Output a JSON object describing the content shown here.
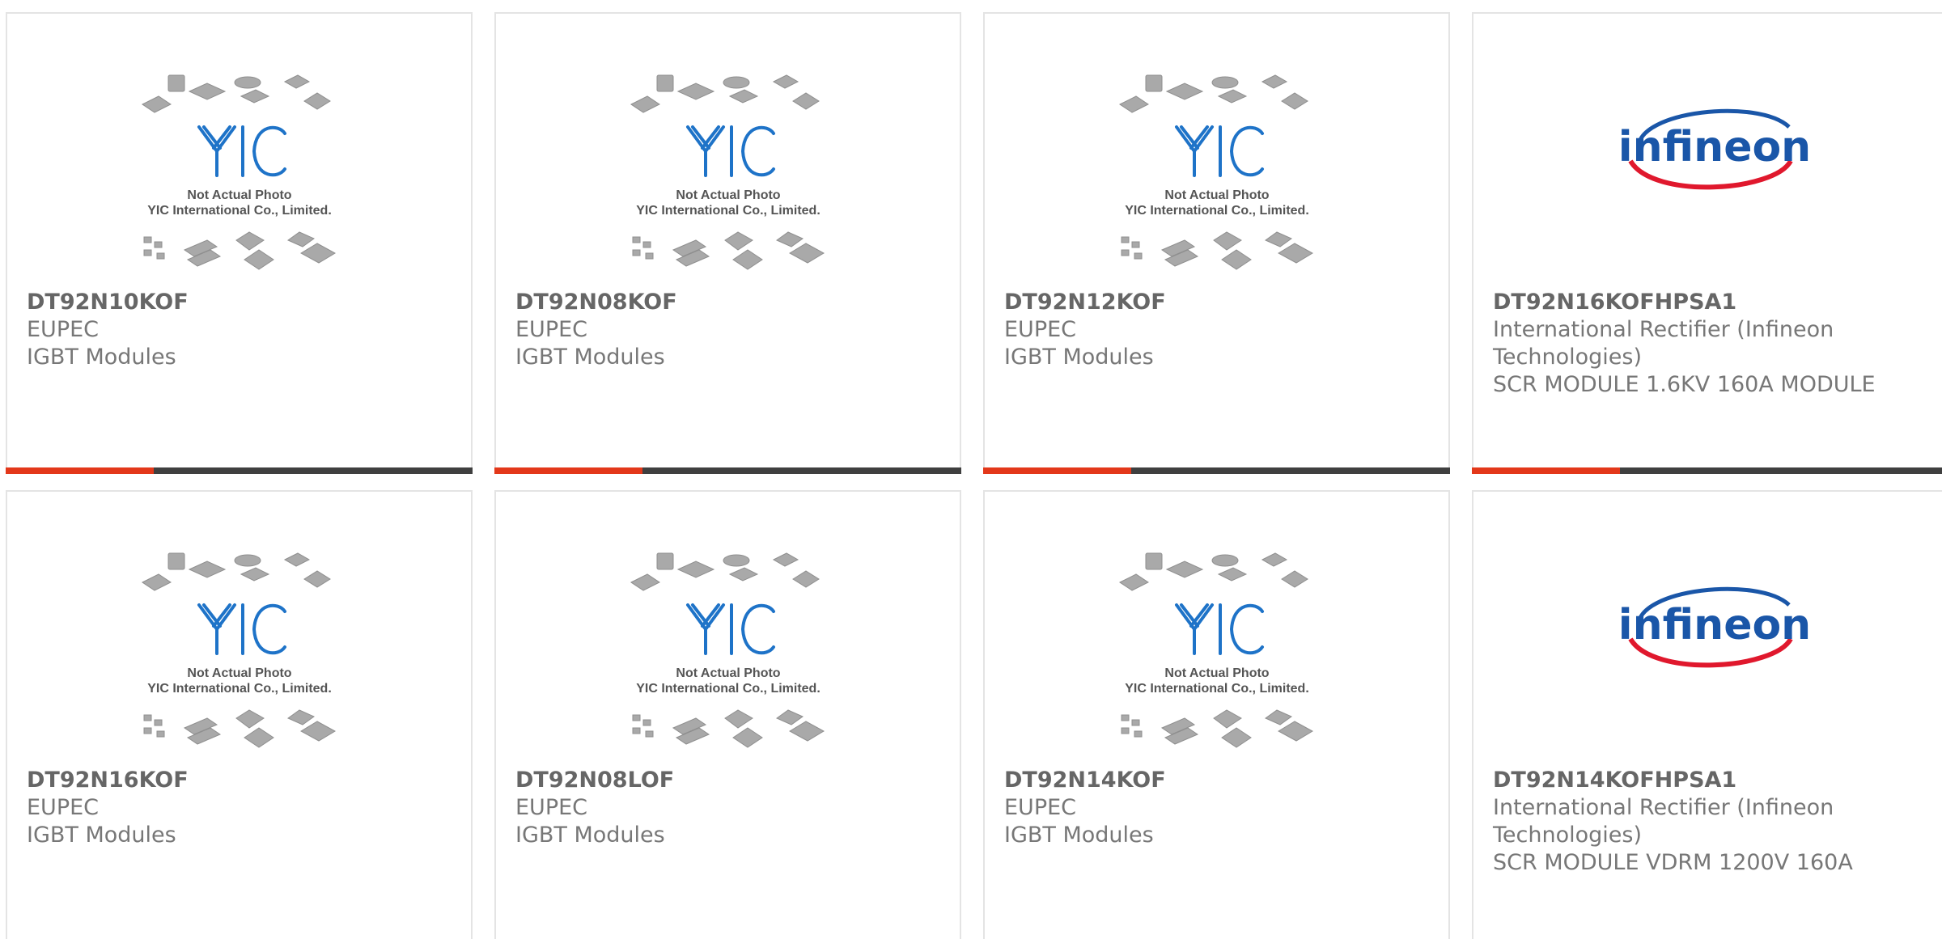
{
  "placeholder": {
    "line1": "Not Actual Photo",
    "line2": "YIC International Co., Limited.",
    "logo": "YIC"
  },
  "brand_logo": "infineon",
  "colors": {
    "accent": "#e3381a",
    "bar": "#3f3f3f",
    "yic_blue": "#1e73c8",
    "infineon_blue": "#1a56a8",
    "infineon_red": "#e0182d"
  },
  "products": [
    {
      "part": "DT92N10KOF",
      "manufacturer": "EUPEC",
      "description": "IGBT Modules",
      "image": "yic-placeholder"
    },
    {
      "part": "DT92N08KOF",
      "manufacturer": "EUPEC",
      "description": "IGBT Modules",
      "image": "yic-placeholder"
    },
    {
      "part": "DT92N12KOF",
      "manufacturer": "EUPEC",
      "description": "IGBT Modules",
      "image": "yic-placeholder"
    },
    {
      "part": "DT92N16KOFHPSA1",
      "manufacturer": "International Rectifier (Infineon Technologies)",
      "description": "SCR MODULE 1.6KV 160A MODULE",
      "image": "infineon-logo"
    },
    {
      "part": "DT92N16KOF",
      "manufacturer": "EUPEC",
      "description": "IGBT Modules",
      "image": "yic-placeholder"
    },
    {
      "part": "DT92N08LOF",
      "manufacturer": "EUPEC",
      "description": "IGBT Modules",
      "image": "yic-placeholder"
    },
    {
      "part": "DT92N14KOF",
      "manufacturer": "EUPEC",
      "description": "IGBT Modules",
      "image": "yic-placeholder"
    },
    {
      "part": "DT92N14KOFHPSA1",
      "manufacturer": "International Rectifier (Infineon Technologies)",
      "description": "SCR MODULE VDRM 1200V 160A",
      "image": "infineon-logo"
    }
  ]
}
